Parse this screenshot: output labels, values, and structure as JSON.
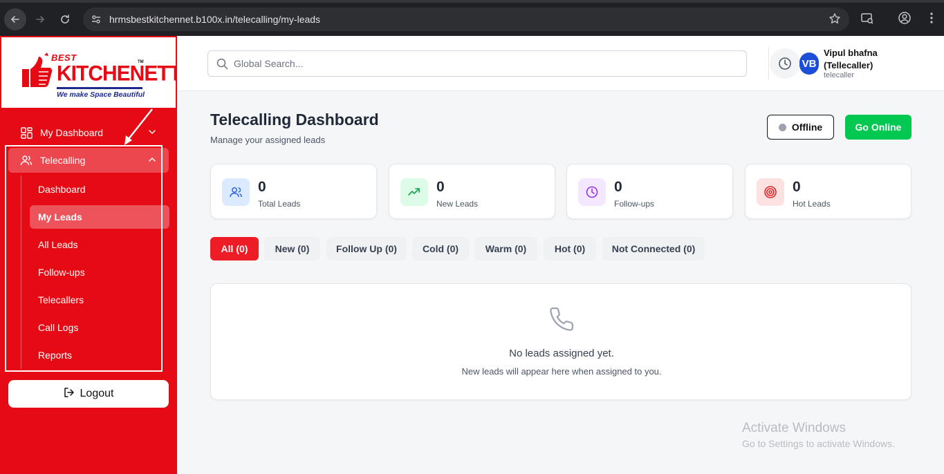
{
  "browser": {
    "url": "hrmsbestkitchennet.b100x.in/telecalling/my-leads"
  },
  "logo": {
    "best": "BEST",
    "name": "KITCHENETTE",
    "tm": "TM",
    "tagline": "We make Space Beautiful"
  },
  "sidebar": {
    "my_dashboard": "My Dashboard",
    "telecalling": "Telecalling",
    "sub_items": [
      {
        "label": "Dashboard"
      },
      {
        "label": "My Leads"
      },
      {
        "label": "All Leads"
      },
      {
        "label": "Follow-ups"
      },
      {
        "label": "Telecallers"
      },
      {
        "label": "Call Logs"
      },
      {
        "label": "Reports"
      }
    ],
    "active_item": "My Leads",
    "logout": "Logout"
  },
  "header": {
    "search_placeholder": "Global Search...",
    "avatar_initials": "VB",
    "user_name": "Vipul bhafna (Tellecaller)",
    "user_role": "telecaller"
  },
  "main": {
    "title": "Telecalling Dashboard",
    "subtitle": "Manage your assigned leads",
    "offline_label": "Offline",
    "online_label": "Go Online",
    "stats": [
      {
        "value": "0",
        "label": "Total Leads",
        "icon": "users-icon",
        "color": "#2563eb",
        "bg": "#dbeafe"
      },
      {
        "value": "0",
        "label": "New Leads",
        "icon": "trending-up-icon",
        "color": "#16a34a",
        "bg": "#dcfce7"
      },
      {
        "value": "0",
        "label": "Follow-ups",
        "icon": "clock-icon",
        "color": "#9333ea",
        "bg": "#f3e8ff"
      },
      {
        "value": "0",
        "label": "Hot Leads",
        "icon": "target-icon",
        "color": "#dc2626",
        "bg": "#fee2e2"
      }
    ],
    "filters": [
      {
        "label": "All (0)",
        "active": true
      },
      {
        "label": "New (0)"
      },
      {
        "label": "Follow Up (0)"
      },
      {
        "label": "Cold (0)"
      },
      {
        "label": "Warm (0)"
      },
      {
        "label": "Hot (0)"
      },
      {
        "label": "Not Connected (0)"
      }
    ],
    "empty_title": "No leads assigned yet.",
    "empty_subtitle": "New leads will appear here when assigned to you."
  },
  "watermark": {
    "line1": "Activate Windows",
    "line2": "Go to Settings to activate Windows."
  },
  "colors": {
    "brand_red": "#e60a14",
    "online_green": "#00c851",
    "active_filter": "#ee1c25"
  }
}
